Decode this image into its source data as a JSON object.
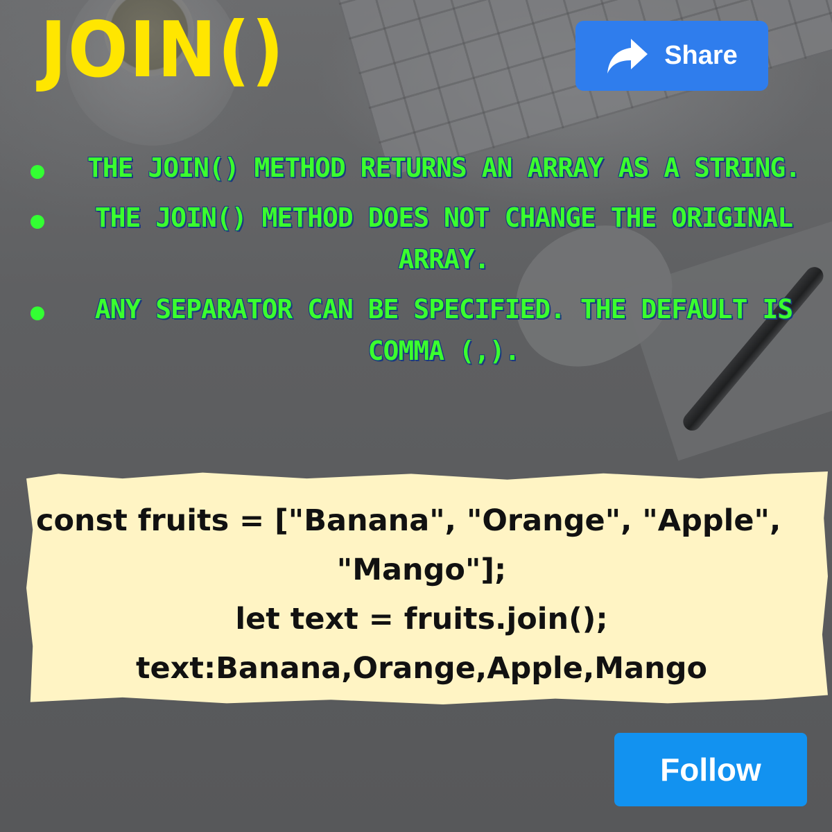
{
  "title": "JOIN()",
  "share_button": {
    "label": "Share",
    "icon": "share-arrow-icon"
  },
  "follow_button": {
    "label": "Follow"
  },
  "bullets": [
    "The join() method returns an array as a string.",
    "The join() method does not change the original array.",
    "Any separator can be specified. The default is comma (,)."
  ],
  "code": {
    "line1": "const fruits = [\"Banana\", \"Orange\", \"Apple\",",
    "line2": "\"Mango\"];",
    "line3": "let text = fruits.join();",
    "line4": "text:Banana,Orange,Apple,Mango"
  },
  "colors": {
    "title": "#ffe600",
    "bullet_text": "#3bff2e",
    "share_button": "#2f7ded",
    "follow_button": "#1292f0",
    "code_card": "#fff4c4"
  }
}
